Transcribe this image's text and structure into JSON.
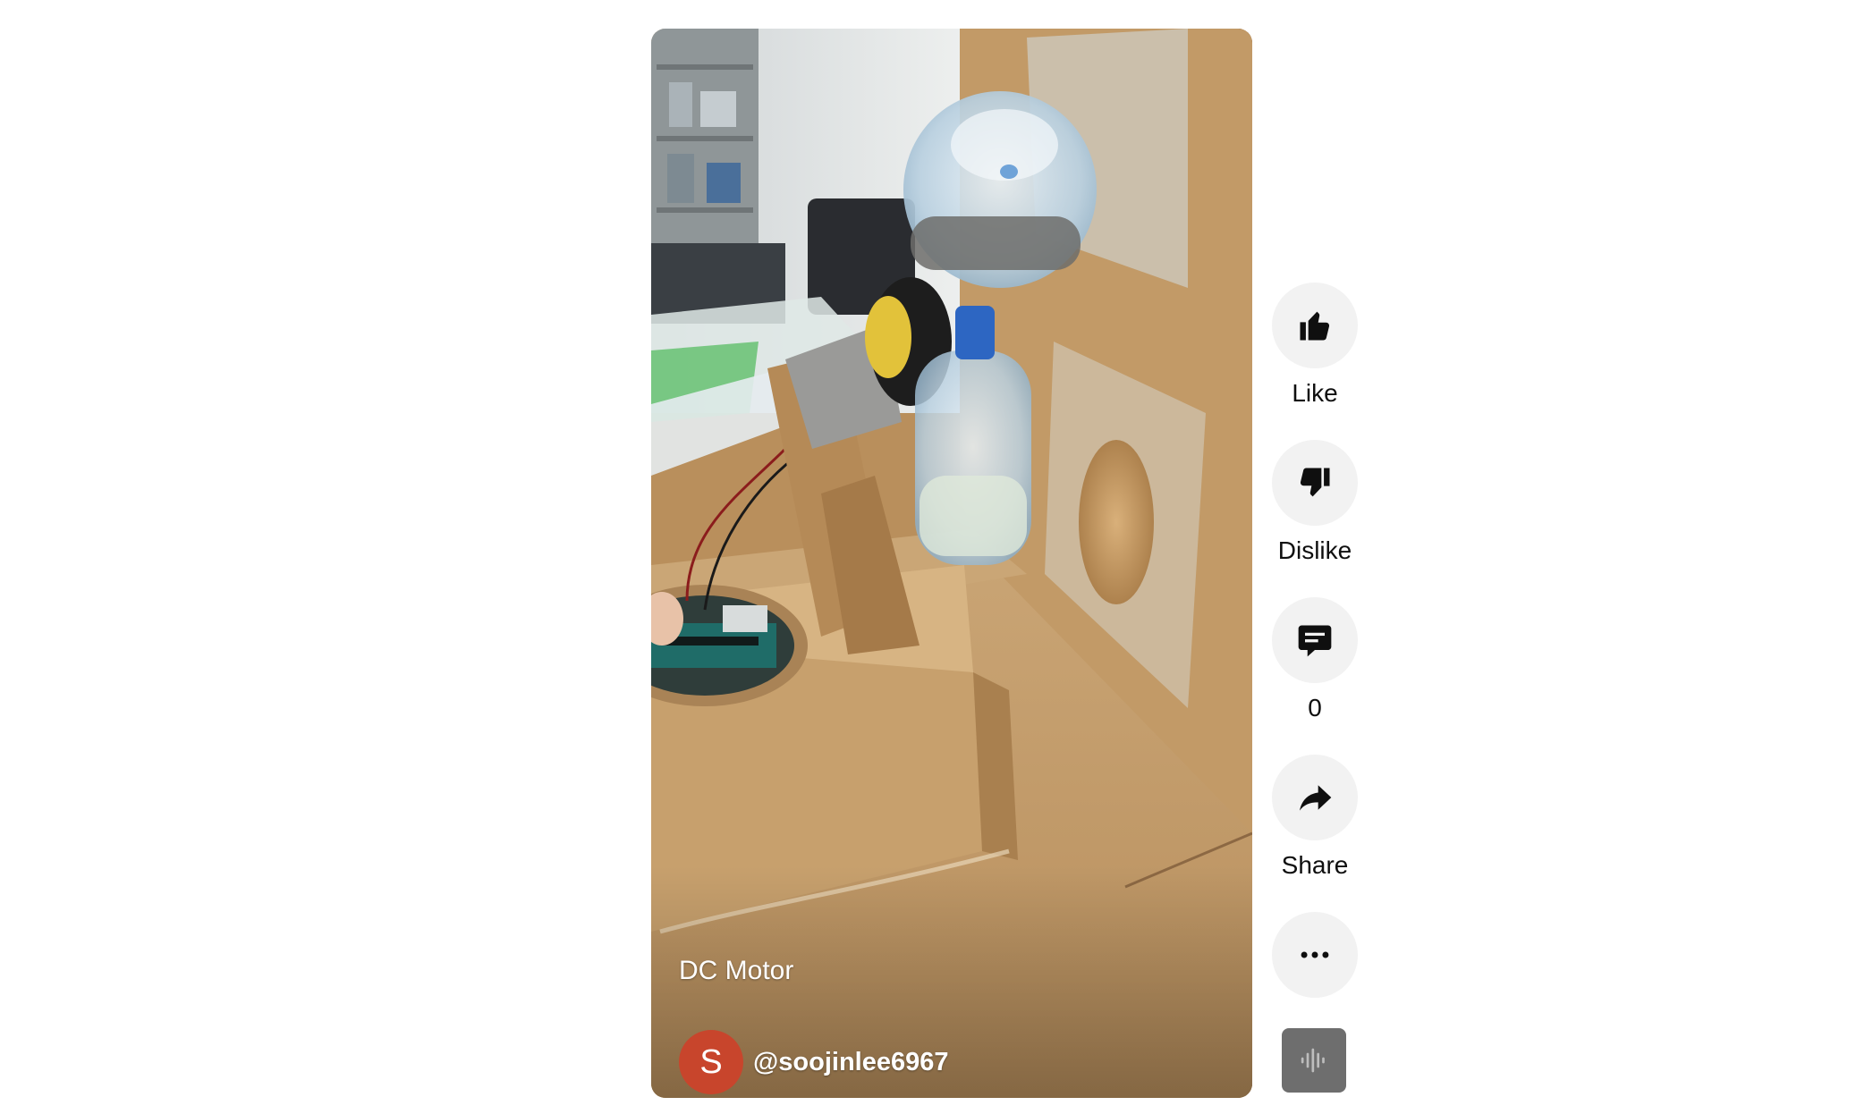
{
  "video": {
    "title": "DC Motor",
    "channel": {
      "avatar_letter": "S",
      "avatar_color": "#c8452c",
      "handle": "@soojinlee6967"
    }
  },
  "actions": [
    {
      "id": "like",
      "icon": "thumbs-up-icon",
      "label": "Like"
    },
    {
      "id": "dislike",
      "icon": "thumbs-down-icon",
      "label": "Dislike"
    },
    {
      "id": "comments",
      "icon": "comment-icon",
      "label": "0"
    },
    {
      "id": "share",
      "icon": "share-arrow-icon",
      "label": "Share"
    },
    {
      "id": "more",
      "icon": "more-horizontal-icon",
      "label": ""
    }
  ],
  "sound": {
    "icon": "audio-waveform-icon"
  },
  "colors": {
    "action_button_bg": "#f2f2f2",
    "icon": "#0f0f0f",
    "audio_tile_bg": "#6e6e6e"
  }
}
